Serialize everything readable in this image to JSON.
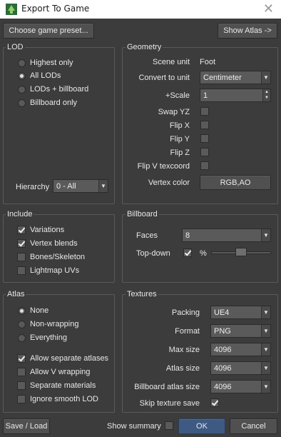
{
  "window": {
    "title": "Export To Game",
    "close_glyph": "✕"
  },
  "top_buttons": {
    "preset": "Choose game preset...",
    "show_atlas": "Show Atlas ->"
  },
  "lod": {
    "title": "LOD",
    "options": [
      {
        "label": "Highest only",
        "selected": false
      },
      {
        "label": "All LODs",
        "selected": true
      },
      {
        "label": "LODs + billboard",
        "selected": false
      },
      {
        "label": "Billboard only",
        "selected": false
      }
    ],
    "hierarchy_label": "Hierarchy",
    "hierarchy_value": "0 - All"
  },
  "geometry": {
    "title": "Geometry",
    "scene_unit_label": "Scene unit",
    "scene_unit_value": "Foot",
    "convert_label": "Convert to unit",
    "convert_value": "Centimeter",
    "scale_label": "+Scale",
    "scale_value": "1",
    "swap_yz_label": "Swap YZ",
    "swap_yz": false,
    "flip_x_label": "Flip X",
    "flip_x": false,
    "flip_y_label": "Flip Y",
    "flip_y": false,
    "flip_z_label": "Flip Z",
    "flip_z": false,
    "flip_v_label": "Flip V texcoord",
    "flip_v": false,
    "vertex_color_label": "Vertex color",
    "vertex_color_value": "RGB,AO"
  },
  "include": {
    "title": "Include",
    "items": [
      {
        "label": "Variations",
        "checked": true
      },
      {
        "label": "Vertex blends",
        "checked": true
      },
      {
        "label": "Bones/Skeleton",
        "checked": false
      },
      {
        "label": "Lightmap UVs",
        "checked": false
      }
    ]
  },
  "billboard": {
    "title": "Billboard",
    "faces_label": "Faces",
    "faces_value": "8",
    "topdown_label": "Top-down",
    "topdown_checked": true,
    "percent_label": "%",
    "slider_level": 0.5
  },
  "atlas": {
    "title": "Atlas",
    "options": [
      {
        "label": "None",
        "selected": true
      },
      {
        "label": "Non-wrapping",
        "selected": false
      },
      {
        "label": "Everything",
        "selected": false
      }
    ],
    "checks": [
      {
        "label": "Allow separate atlases",
        "checked": true
      },
      {
        "label": "Allow V wrapping",
        "checked": false
      },
      {
        "label": "Separate materials",
        "checked": false
      },
      {
        "label": "Ignore smooth LOD",
        "checked": false
      }
    ]
  },
  "textures": {
    "title": "Textures",
    "packing_label": "Packing",
    "packing_value": "UE4",
    "format_label": "Format",
    "format_value": "PNG",
    "max_size_label": "Max size",
    "max_size_value": "4096",
    "atlas_size_label": "Atlas size",
    "atlas_size_value": "4096",
    "bb_atlas_label": "Billboard atlas size",
    "bb_atlas_value": "4096",
    "skip_label": "Skip texture save",
    "skip_checked": true
  },
  "footer": {
    "save_load": "Save / Load",
    "show_summary": "Show summary",
    "show_summary_checked": false,
    "ok": "OK",
    "cancel": "Cancel"
  },
  "colors": {
    "background": "#3c3c3c",
    "ok_button": "#3e5a82",
    "titlebar": "#ffffff"
  }
}
